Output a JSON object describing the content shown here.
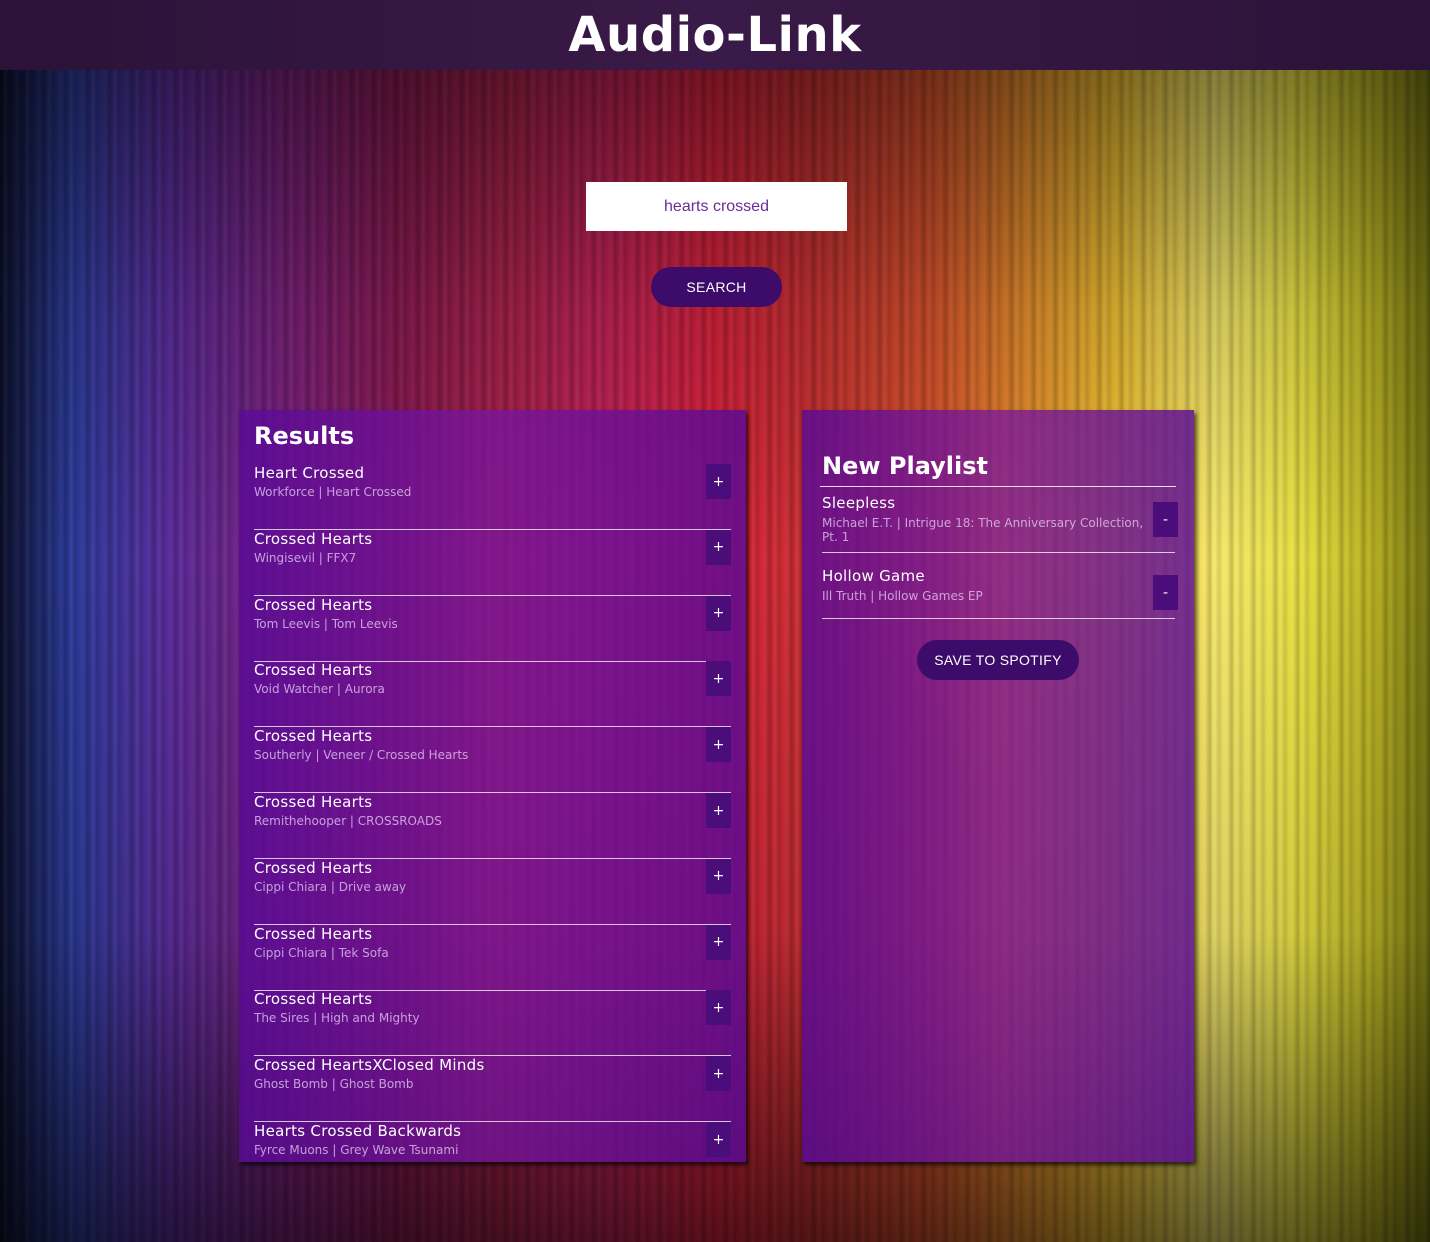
{
  "header": {
    "title": "Audio-Link"
  },
  "search": {
    "value": "hearts crossed",
    "button_label": "SEARCH"
  },
  "results": {
    "title": "Results",
    "add_label": "+",
    "tracks": [
      {
        "name": "Heart Crossed",
        "info": "Workforce | Heart Crossed"
      },
      {
        "name": "Crossed Hearts",
        "info": "Wingisevil | FFX7"
      },
      {
        "name": "Crossed Hearts",
        "info": "Tom Leevis | Tom Leevis"
      },
      {
        "name": "Crossed Hearts",
        "info": "Void Watcher | Aurora"
      },
      {
        "name": "Crossed Hearts",
        "info": "Southerly | Veneer / Crossed Hearts"
      },
      {
        "name": "Crossed Hearts",
        "info": "Remithehooper | CROSSROADS"
      },
      {
        "name": "Crossed Hearts",
        "info": "Cippi Chiara | Drive away"
      },
      {
        "name": "Crossed Hearts",
        "info": "Cippi Chiara | Tek Sofa"
      },
      {
        "name": "Crossed Hearts",
        "info": "The Sires | High and Mighty"
      },
      {
        "name": "Crossed HeartsXClosed Minds",
        "info": "Ghost Bomb | Ghost Bomb"
      },
      {
        "name": "Hearts Crossed Backwards",
        "info": "Fyrce Muons | Grey Wave Tsunami"
      }
    ]
  },
  "playlist": {
    "title": "New Playlist",
    "remove_label": "-",
    "tracks": [
      {
        "name": "Sleepless",
        "info": "Michael E.T. | Intrigue 18: The Anniversary Collection, Pt. 1"
      },
      {
        "name": "Hollow Game",
        "info": "Ill Truth | Hollow Games EP"
      }
    ],
    "save_label": "SAVE TO SPOTIFY"
  }
}
